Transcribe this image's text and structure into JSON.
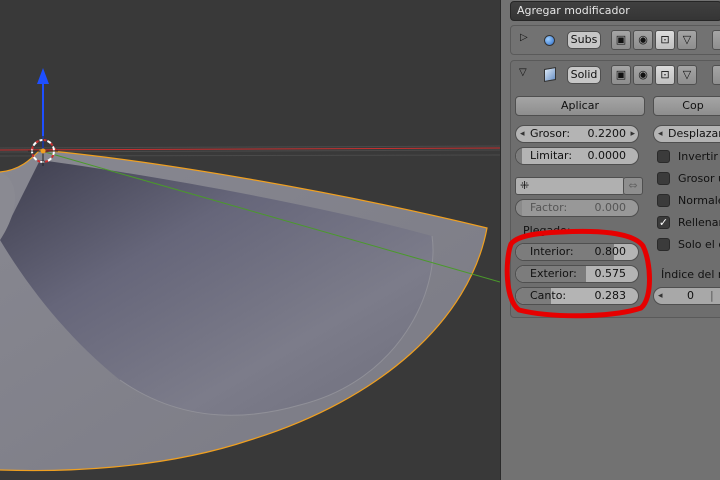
{
  "panel": {
    "add_modifier_label": "Agregar modificador",
    "modifiers": [
      {
        "name": "Subs",
        "type_icon": "subsurf-icon",
        "expanded": false
      },
      {
        "name": "Solid",
        "type_icon": "solidify-icon",
        "expanded": true
      }
    ],
    "solidify": {
      "apply_label": "Aplicar",
      "copy_label": "Cop",
      "thickness": {
        "label": "Grosor:",
        "value": "0.2200"
      },
      "clamp": {
        "label": "Limitar:",
        "value": "0.0000"
      },
      "factor": {
        "label": "Factor:",
        "value": "0.000"
      },
      "offset_label": "Desplazam",
      "crease_heading": "Plegado:",
      "crease_inner": {
        "label": "Interior:",
        "value": "0.800",
        "level": 0.8
      },
      "crease_outer": {
        "label": "Exterior:",
        "value": "0.575",
        "level": 0.575
      },
      "crease_rim": {
        "label": "Canto:",
        "value": "0.283",
        "level": 0.283
      },
      "options": [
        {
          "label": "Invertir n",
          "checked": false
        },
        {
          "label": "Grosor u",
          "checked": false
        },
        {
          "label": "Normale",
          "checked": false
        },
        {
          "label": "Rellenar",
          "checked": true
        },
        {
          "label": "Solo el c",
          "checked": false
        }
      ],
      "material_index_label": "Índice del m",
      "material_index_value": "0"
    }
  },
  "colors": {
    "annotation_red": "#e60000",
    "selection_orange": "#f0a020",
    "axis_blue": "#1e4fff",
    "axis_green": "#4a9a2a",
    "axis_red": "#c83030"
  }
}
